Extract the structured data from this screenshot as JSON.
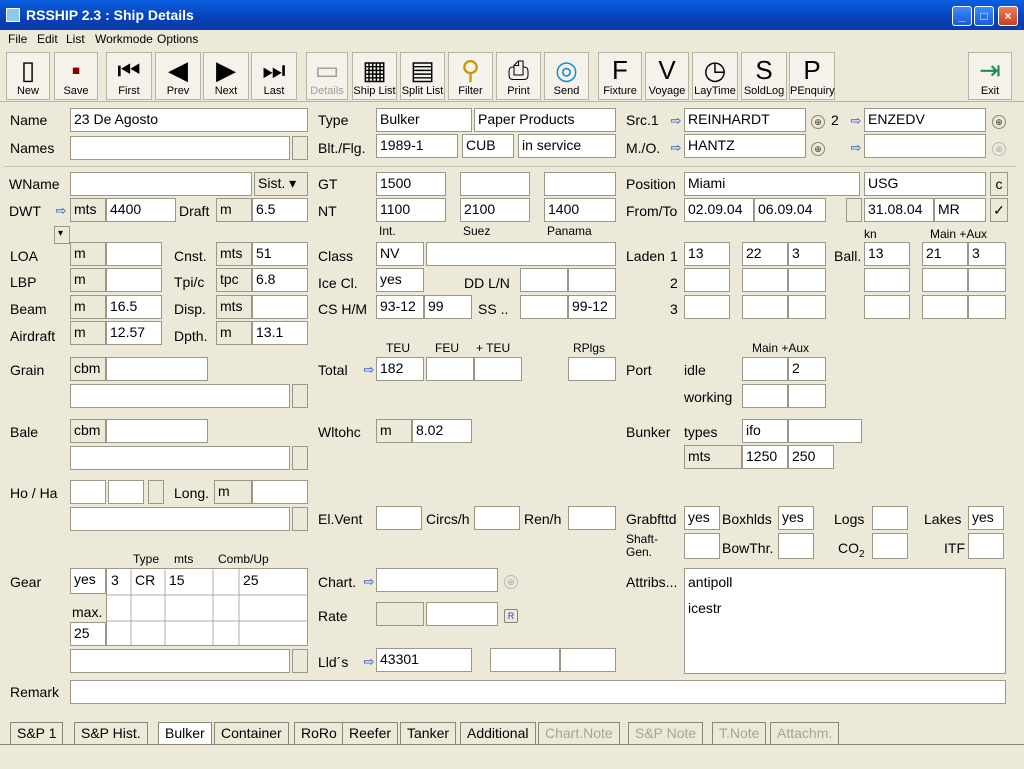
{
  "window": {
    "title": "RSSHIP 2.3 : Ship Details"
  },
  "menu": [
    "File",
    "Edit",
    "List",
    "Workmode",
    "Options"
  ],
  "toolbar": [
    {
      "label": "New",
      "icon": "new-icon",
      "glyph": "▯"
    },
    {
      "label": "Save",
      "icon": "save-icon",
      "glyph": "▪"
    },
    {
      "label": "First",
      "icon": "first-icon",
      "glyph": "⏮"
    },
    {
      "label": "Prev",
      "icon": "prev-icon",
      "glyph": "◀"
    },
    {
      "label": "Next",
      "icon": "next-icon",
      "glyph": "▶"
    },
    {
      "label": "Last",
      "icon": "last-icon",
      "glyph": "⏭"
    },
    {
      "label": "Details",
      "icon": "details-icon",
      "glyph": "▭"
    },
    {
      "label": "Ship List",
      "icon": "ship-list-icon",
      "glyph": "▦"
    },
    {
      "label": "Split List",
      "icon": "split-list-icon",
      "glyph": "▤"
    },
    {
      "label": "Filter",
      "icon": "filter-icon",
      "glyph": "⚲"
    },
    {
      "label": "Print",
      "icon": "print-icon",
      "glyph": "⎙"
    },
    {
      "label": "Send",
      "icon": "send-icon",
      "glyph": "◎"
    },
    {
      "label": "Fixture",
      "icon": "fixture-icon",
      "glyph": "F"
    },
    {
      "label": "Voyage",
      "icon": "voyage-icon",
      "glyph": "V"
    },
    {
      "label": "LayTime",
      "icon": "laytime-icon",
      "glyph": "◷"
    },
    {
      "label": "SoldLog",
      "icon": "soldlog-icon",
      "glyph": "S"
    },
    {
      "label": "PEnquiry",
      "icon": "penquiry-icon",
      "glyph": "P"
    },
    {
      "label": "Exit",
      "icon": "exit-icon",
      "glyph": "⇥"
    }
  ],
  "form": {
    "name_label": "Name",
    "name": "23 De Agosto",
    "names_label": "Names",
    "names": "",
    "type_label": "Type",
    "type": "Bulker",
    "type2": "Paper Products",
    "blt_label": "Blt./Flg.",
    "built": "1989-1",
    "flag": "CUB",
    "status": "in service",
    "src1_label": "Src.1",
    "src1": "REINHARDT",
    "src2_num": "2",
    "src2": "ENZEDV",
    "mo_label": "M./O.",
    "mo": "HANTZ",
    "mo2": "",
    "wname_label": "WName",
    "wname": "",
    "sist_label": "Sist.",
    "dwt_label": "DWT",
    "dwt_unit": "mts",
    "dwt": "4400",
    "draft_label": "Draft",
    "draft_unit": "m",
    "draft": "6.5",
    "gt_label": "GT",
    "gt": "1500",
    "gt2": "",
    "gt3": "",
    "nt_label": "NT",
    "nt": "1100",
    "nt_suez": "2100",
    "nt_panama": "1400",
    "int_label": "Int.",
    "suez_label": "Suez",
    "panama_label": "Panama",
    "position_label": "Position",
    "position": "Miami",
    "position2": "USG",
    "pos_btn": "c",
    "fromto_label": "From/To",
    "from": "02.09.04",
    "to": "06.09.04",
    "date3": "31.08.04",
    "date3_code": "MR",
    "check": "✓",
    "loa_label": "LOA",
    "loa_unit": "m",
    "loa": "",
    "cnst_label": "Cnst.",
    "cnst_unit": "mts",
    "cnst": "51",
    "class_label": "Class",
    "class": "NV",
    "class2": "",
    "lbp_label": "LBP",
    "lbp_unit": "m",
    "lbp": "",
    "tpic_label": "Tpi/c",
    "tpic_unit": "tpc",
    "tpic": "6.8",
    "icecl_label": "Ice Cl.",
    "icecl": "yes",
    "ddln_label": "DD L/N",
    "beam_label": "Beam",
    "beam_unit": "m",
    "beam": "16.5",
    "disp_label": "Disp.",
    "disp_unit": "mts",
    "disp": "",
    "cshm_label": "CS H/M",
    "cs_h": "93-12",
    "cs_m": "99",
    "ss_label": "SS ..",
    "ss": "99-12",
    "airdraft_label": "Airdraft",
    "airdraft_unit": "m",
    "airdraft": "12.57",
    "dpth_label": "Dpth.",
    "dpth_unit": "m",
    "dpth": "13.1",
    "kn_label": "kn",
    "mainaux_label": "Main +Aux",
    "laden_label": "Laden",
    "laden1_num": "1",
    "laden1_a": "13",
    "laden1_b": "22",
    "laden1_c": "3",
    "laden2_num": "2",
    "laden3_num": "3",
    "ball_label": "Ball.",
    "ball_kn": "13",
    "ball_main": "21",
    "ball_aux": "3",
    "grain_label": "Grain",
    "grain_unit": "cbm",
    "grain": "",
    "teu_label": "TEU",
    "feu_label": "FEU",
    "plusteu_label": "+ TEU",
    "rplgs_label": "RPlgs",
    "total_label": "Total",
    "teu": "182",
    "port_label": "Port",
    "port_mainaux_label": "Main +Aux",
    "idle_label": "idle",
    "idle_aux": "2",
    "working_label": "working",
    "bale_label": "Bale",
    "bale_unit": "cbm",
    "bale": "",
    "wltohc_label": "Wltohc",
    "wltohc_unit": "m",
    "wltohc": "8.02",
    "bunker_label": "Bunker",
    "types_label": "types",
    "bunker_type": "ifo",
    "bunker_unit": "mts",
    "bunker_main": "1250",
    "bunker_aux": "250",
    "hoha_label": "Ho / Ha",
    "long_label": "Long.",
    "long_unit": "m",
    "elvent_label": "El.Vent",
    "circs_label": "Circs/h",
    "renh_label": "Ren/h",
    "grabfttd_label": "Grabfttd",
    "grabfttd": "yes",
    "boxhlds_label": "Boxhlds",
    "boxhlds": "yes",
    "logs_label": "Logs",
    "lakes_label": "Lakes",
    "lakes": "yes",
    "shaftgen_label": "Shaft-\nGen.",
    "bowthr_label": "BowThr.",
    "co2_label": "CO",
    "co2_sub": "2",
    "itf_label": "ITF",
    "gear_label": "Gear",
    "gear": "yes",
    "gear_type_label": "Type",
    "gear_mts_label": "mts",
    "gear_comb_label": "Comb/Up",
    "gear_num": "3",
    "gear_type": "CR",
    "gear_mts": "15",
    "gear_comb": "25",
    "max_label": "max.",
    "gear_max": "25",
    "chart_label": "Chart.",
    "rate_label": "Rate",
    "llds_label": "Lld´s",
    "llds": "43301",
    "attribs_label": "Attribs...",
    "attribs": [
      "antipoll",
      "icestr"
    ],
    "remark_label": "Remark",
    "remark": ""
  },
  "tabs": [
    {
      "label": "S&P 1",
      "state": "normal"
    },
    {
      "label": "S&P Hist.",
      "state": "normal"
    },
    {
      "label": "Bulker",
      "state": "selected"
    },
    {
      "label": "Container",
      "state": "normal"
    },
    {
      "label": "RoRo",
      "state": "normal"
    },
    {
      "label": "Reefer",
      "state": "normal"
    },
    {
      "label": "Tanker",
      "state": "normal"
    },
    {
      "label": "Additional",
      "state": "normal"
    },
    {
      "label": "Chart.Note",
      "state": "disabled"
    },
    {
      "label": "S&P Note",
      "state": "disabled"
    },
    {
      "label": "T.Note",
      "state": "disabled"
    },
    {
      "label": "Attachm.",
      "state": "disabled"
    }
  ]
}
